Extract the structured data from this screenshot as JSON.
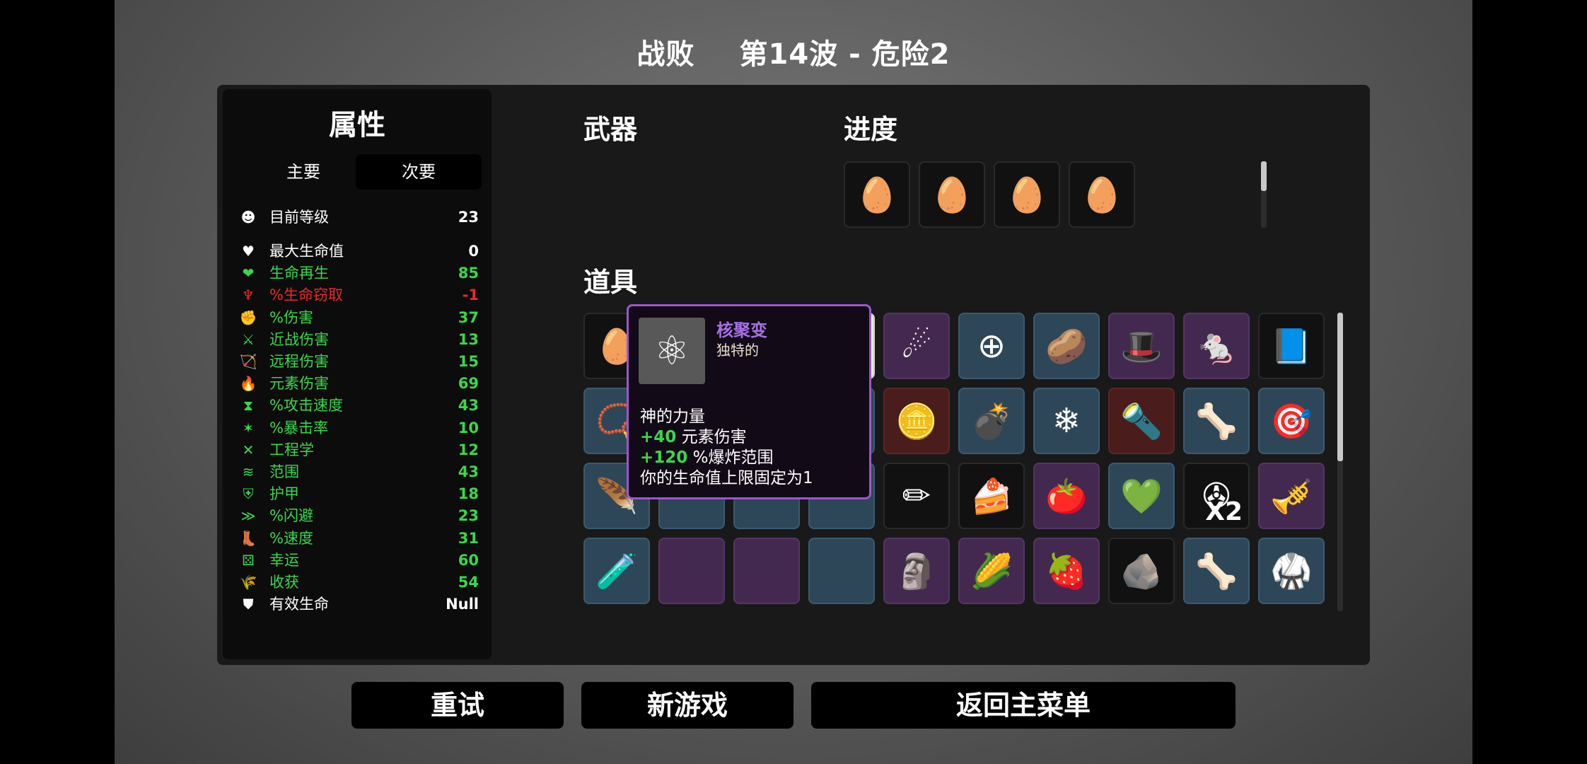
{
  "header": {
    "result": "战败",
    "wave": "第14波 - 危险2"
  },
  "stats_panel": {
    "title": "属性",
    "tabs": [
      "主要",
      "次要"
    ],
    "level": {
      "label": "目前等级",
      "value": "23",
      "icon": "level-icon",
      "color": "#ffffff"
    },
    "items": [
      {
        "label": "最大生命值",
        "value": "0",
        "icon": "heart-icon",
        "color": "#ffffff"
      },
      {
        "label": "生命再生",
        "value": "85",
        "icon": "regen-heart-icon",
        "color": "#39d84a"
      },
      {
        "label": "%生命窃取",
        "value": "-1",
        "icon": "fang-icon",
        "color": "#e82a2a"
      },
      {
        "label": "%伤害",
        "value": "37",
        "icon": "muscle-icon",
        "color": "#39d84a"
      },
      {
        "label": "近战伤害",
        "value": "13",
        "icon": "sword-icon",
        "color": "#39d84a"
      },
      {
        "label": "远程伤害",
        "value": "15",
        "icon": "bow-icon",
        "color": "#39d84a"
      },
      {
        "label": "元素伤害",
        "value": "69",
        "icon": "flame-icon",
        "color": "#39d84a"
      },
      {
        "label": "%攻击速度",
        "value": "43",
        "icon": "hourglass-icon",
        "color": "#39d84a"
      },
      {
        "label": "%暴击率",
        "value": "10",
        "icon": "crit-icon",
        "color": "#39d84a"
      },
      {
        "label": "工程学",
        "value": "12",
        "icon": "wrench-icon",
        "color": "#39d84a"
      },
      {
        "label": "范围",
        "value": "43",
        "icon": "range-icon",
        "color": "#39d84a"
      },
      {
        "label": "护甲",
        "value": "18",
        "icon": "shield-icon",
        "color": "#39d84a"
      },
      {
        "label": "%闪避",
        "value": "23",
        "icon": "dodge-icon",
        "color": "#39d84a"
      },
      {
        "label": "%速度",
        "value": "31",
        "icon": "boot-icon",
        "color": "#39d84a"
      },
      {
        "label": "幸运",
        "value": "60",
        "icon": "dice-icon",
        "color": "#39d84a"
      },
      {
        "label": "收获",
        "value": "54",
        "icon": "wheat-icon",
        "color": "#39d84a"
      },
      {
        "label": "有效生命",
        "value": "Null",
        "icon": "effective-hp-icon",
        "color": "#ffffff"
      }
    ]
  },
  "weapons": {
    "label": "武器"
  },
  "progress": {
    "label": "进度",
    "items": [
      {
        "icon": "grinning-egg-icon",
        "glyph": "🥚"
      },
      {
        "icon": "masked-egg-icon",
        "glyph": "🥚"
      },
      {
        "icon": "bearded-egg-icon",
        "glyph": "🥚"
      },
      {
        "icon": "demon-egg-icon",
        "glyph": "🥚"
      }
    ]
  },
  "items_section": {
    "label": "道具",
    "rows": [
      [
        {
          "icon": "spiked-egg-icon",
          "glyph": "🥚",
          "tier": "dark"
        },
        {
          "icon": "campfire-icon",
          "glyph": "🔥",
          "tier": "blue"
        },
        {
          "icon": "scientist-icon",
          "glyph": "🧪",
          "tier": "purple"
        },
        {
          "icon": "nuclear-fusion-icon",
          "glyph": "⚛",
          "tier": "white"
        },
        {
          "icon": "comet-icon",
          "glyph": "☄",
          "tier": "purple"
        },
        {
          "icon": "crosshair-icon",
          "glyph": "⊕",
          "tier": "blue"
        },
        {
          "icon": "potato-icon",
          "glyph": "🥔",
          "tier": "blue"
        },
        {
          "icon": "hat-icon",
          "glyph": "🎩",
          "tier": "purple"
        },
        {
          "icon": "rat-icon",
          "glyph": "🐁",
          "tier": "purple"
        },
        {
          "icon": "book-icon",
          "glyph": "📘",
          "tier": "dark"
        }
      ],
      [
        {
          "icon": "amulet-icon",
          "glyph": "📿",
          "tier": "blue"
        },
        {
          "icon": "hidden-item-icon",
          "glyph": "",
          "tier": "blue"
        },
        {
          "icon": "hidden-item-icon",
          "glyph": "",
          "tier": "blue"
        },
        {
          "icon": "hidden-item-icon",
          "glyph": "",
          "tier": "blue"
        },
        {
          "icon": "gold-coin-icon",
          "glyph": "🪙",
          "tier": "red"
        },
        {
          "icon": "spiked-mine-icon",
          "glyph": "💣",
          "tier": "blue"
        },
        {
          "icon": "ice-crystal-icon",
          "glyph": "❄",
          "tier": "blue"
        },
        {
          "icon": "laser-pointer-icon",
          "glyph": "🔦",
          "tier": "red"
        },
        {
          "icon": "claw-icon",
          "glyph": "🦴",
          "tier": "blue"
        },
        {
          "icon": "target-ring-icon",
          "glyph": "🎯",
          "tier": "blue"
        }
      ],
      [
        {
          "icon": "feather-icon",
          "glyph": "🪶",
          "tier": "blue"
        },
        {
          "icon": "hidden-item-icon",
          "glyph": "",
          "tier": "blue"
        },
        {
          "icon": "hidden-item-icon",
          "glyph": "",
          "tier": "blue"
        },
        {
          "icon": "hidden-item-icon",
          "glyph": "",
          "tier": "blue"
        },
        {
          "icon": "pencil-icon",
          "glyph": "✏",
          "tier": "dark"
        },
        {
          "icon": "cake-icon",
          "glyph": "🍰",
          "tier": "dark"
        },
        {
          "icon": "tomato-face-icon",
          "glyph": "🍅",
          "tier": "purple"
        },
        {
          "icon": "map-heart-icon",
          "glyph": "💚",
          "tier": "blue"
        },
        {
          "icon": "propeller-icon",
          "glyph": "✇",
          "tier": "dark",
          "count": "X2"
        },
        {
          "icon": "gold-trumpet-icon",
          "glyph": "🎺",
          "tier": "purple"
        }
      ],
      [
        {
          "icon": "green-potion-icon",
          "glyph": "🧪",
          "tier": "blue"
        },
        {
          "icon": "hidden-item-icon",
          "glyph": "",
          "tier": "purple"
        },
        {
          "icon": "hidden-item-icon",
          "glyph": "",
          "tier": "purple"
        },
        {
          "icon": "hidden-item-icon",
          "glyph": "",
          "tier": "blue"
        },
        {
          "icon": "totem-icon",
          "glyph": "🗿",
          "tier": "purple"
        },
        {
          "icon": "cornucopia-icon",
          "glyph": "🌽",
          "tier": "purple"
        },
        {
          "icon": "strawberry-icon",
          "glyph": "🍓",
          "tier": "purple"
        },
        {
          "icon": "rock-icon",
          "glyph": "🪨",
          "tier": "dark"
        },
        {
          "icon": "slingshot-icon",
          "glyph": "🦴",
          "tier": "blue"
        },
        {
          "icon": "black-belt-icon",
          "glyph": "🥋",
          "tier": "blue"
        }
      ]
    ]
  },
  "tooltip": {
    "icon": "nuclear-fusion-icon",
    "glyph": "⚛",
    "name": "核聚变",
    "rarity": "独特的",
    "desc_title": "神的力量",
    "effect1_value": "+40",
    "effect1_text": " 元素伤害",
    "effect2_value": "+120",
    "effect2_text": " %爆炸范围",
    "effect3_text": "你的生命值上限固定为1"
  },
  "buttons": {
    "retry": "重试",
    "new_game": "新游戏",
    "main_menu": "返回主菜单"
  },
  "colors": {
    "tooltip_border": "#9d56d0",
    "tooltip_name": "#a770e6",
    "positive": "#39d84a",
    "negative": "#e82a2a"
  }
}
